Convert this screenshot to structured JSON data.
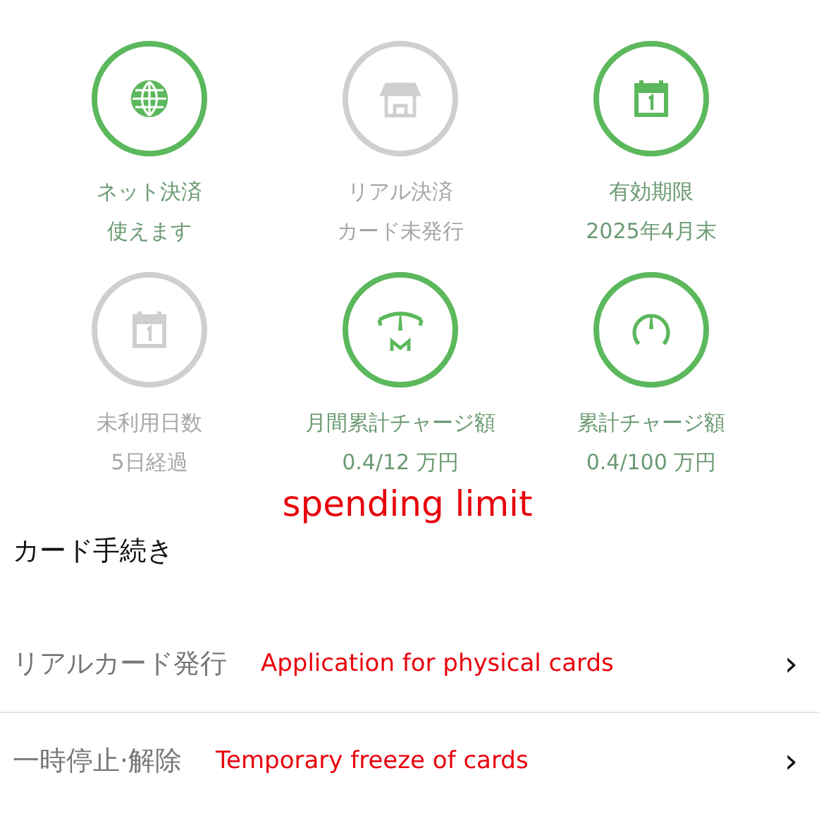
{
  "tiles": [
    {
      "kind": "globe",
      "active": true,
      "label": "ネット決済",
      "value": "使えます"
    },
    {
      "kind": "shop",
      "active": false,
      "label": "リアル決済",
      "value": "カード未発行"
    },
    {
      "kind": "calendar",
      "active": true,
      "label": "有効期限",
      "value": "2025年4月末"
    },
    {
      "kind": "calendar",
      "active": false,
      "label": "未利用日数",
      "value": "5日経過"
    },
    {
      "kind": "gauge-m",
      "active": true,
      "label": "月間累計チャージ額",
      "value": "0.4/12 万円"
    },
    {
      "kind": "gauge",
      "active": true,
      "label": "累計チャージ額",
      "value": "0.4/100 万円"
    }
  ],
  "tiles_annotation": "spending limit",
  "section": {
    "title": "カード手続き",
    "items": [
      {
        "label": "リアルカード発行",
        "annotation": "Application for physical cards",
        "chevron": "›"
      },
      {
        "label": "一時停止·解除",
        "annotation": "Temporary freeze of cards",
        "chevron": "›"
      }
    ]
  }
}
